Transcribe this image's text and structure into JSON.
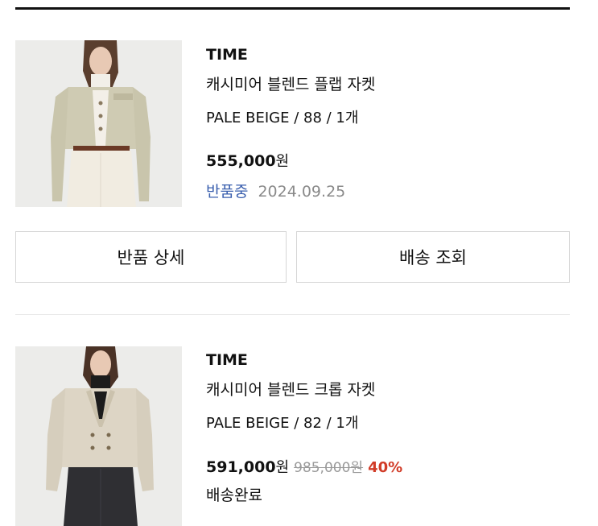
{
  "items": [
    {
      "brand": "TIME",
      "name": "캐시미어 블렌드 플랩 자켓",
      "option": "PALE BEIGE / 88 / 1개",
      "price": "555,000",
      "unit": "원",
      "status": "반품중",
      "date": "2024.09.25",
      "image_desc": "product-photo-flap-jacket"
    },
    {
      "brand": "TIME",
      "name": "캐시미어 블렌드 크롭 자켓",
      "option": "PALE BEIGE / 82 / 1개",
      "price": "591,000",
      "unit": "원",
      "original_price": "985,000원",
      "discount": "40%",
      "status": "배송완료",
      "image_desc": "product-photo-crop-jacket"
    }
  ],
  "buttons": {
    "return_detail": "반품 상세",
    "track_delivery": "배송 조회"
  },
  "colors": {
    "status_blue": "#3a5fae",
    "discount_red": "#d13c28",
    "rule": "#111111"
  }
}
